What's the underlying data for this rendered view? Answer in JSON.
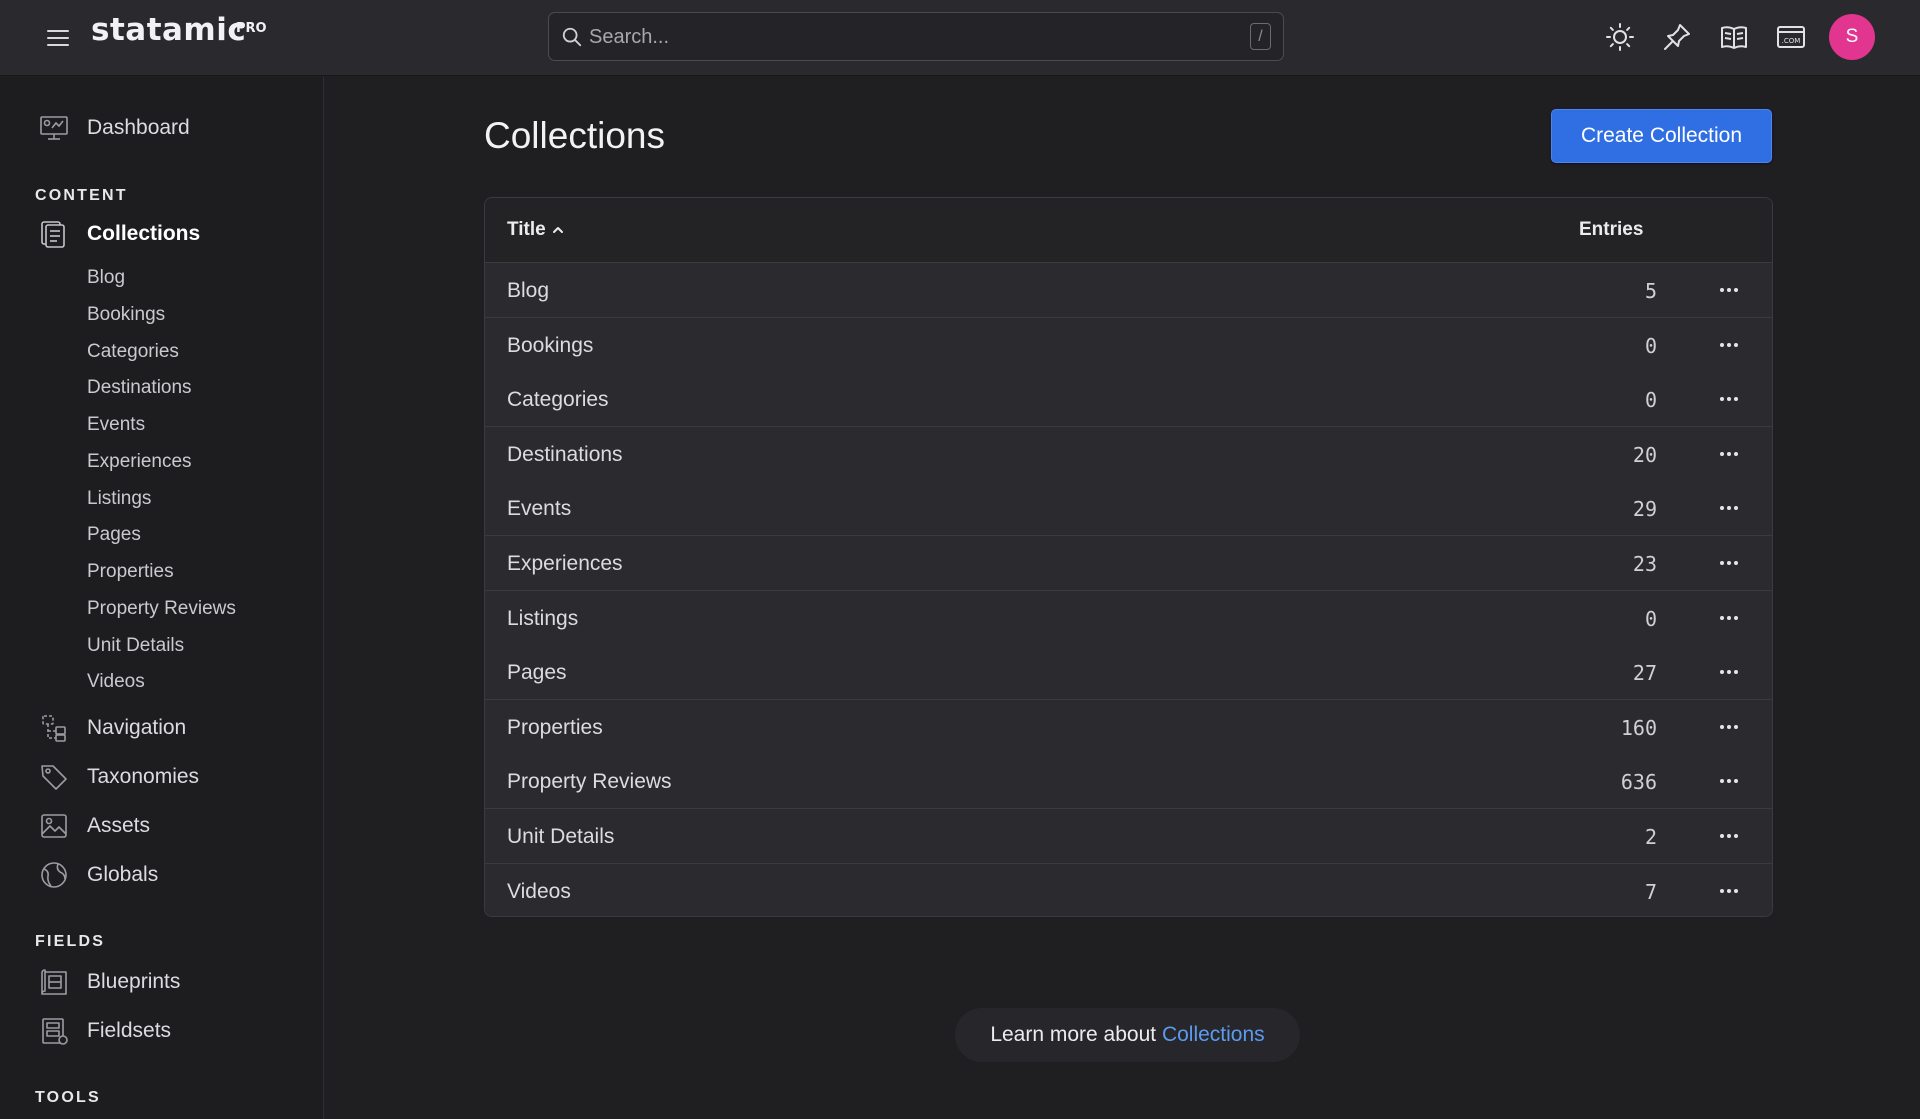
{
  "app": {
    "logo": "statamic",
    "logo_badge": "PRO",
    "avatar_initial": "S",
    "accent_color": "#2f6fe3",
    "avatar_color": "#e1358f"
  },
  "search": {
    "placeholder": "Search...",
    "shortcut": "/"
  },
  "topbar_icons": [
    "theme-sun-icon",
    "pin-icon",
    "docs-book-icon",
    "site-com-icon"
  ],
  "sidebar": {
    "dashboard": "Dashboard",
    "content_title": "CONTENT",
    "collections": "Collections",
    "collection_items": [
      "Blog",
      "Bookings",
      "Categories",
      "Destinations",
      "Events",
      "Experiences",
      "Listings",
      "Pages",
      "Properties",
      "Property Reviews",
      "Unit Details",
      "Videos"
    ],
    "navigation": "Navigation",
    "taxonomies": "Taxonomies",
    "assets": "Assets",
    "globals": "Globals",
    "fields_title": "FIELDS",
    "blueprints": "Blueprints",
    "fieldsets": "Fieldsets",
    "tools_title": "TOOLS"
  },
  "main": {
    "title": "Collections",
    "create_button": "Create Collection",
    "table": {
      "col_title": "Title",
      "col_entries": "Entries",
      "rows": [
        {
          "title": "Blog",
          "entries": "5"
        },
        {
          "title": "Bookings",
          "entries": "0"
        },
        {
          "title": "Categories",
          "entries": "0"
        },
        {
          "title": "Destinations",
          "entries": "20"
        },
        {
          "title": "Events",
          "entries": "29"
        },
        {
          "title": "Experiences",
          "entries": "23"
        },
        {
          "title": "Listings",
          "entries": "0"
        },
        {
          "title": "Pages",
          "entries": "27"
        },
        {
          "title": "Properties",
          "entries": "160"
        },
        {
          "title": "Property Reviews",
          "entries": "636"
        },
        {
          "title": "Unit Details",
          "entries": "2"
        },
        {
          "title": "Videos",
          "entries": "7"
        }
      ]
    },
    "learn_prefix": "Learn more about ",
    "learn_link": "Collections"
  }
}
